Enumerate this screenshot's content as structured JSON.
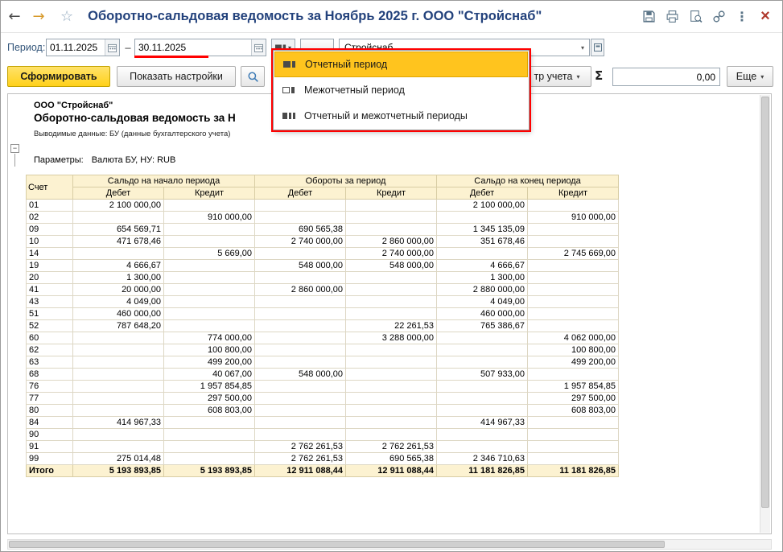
{
  "titlebar": {
    "title": "Оборотно-сальдовая ведомость за Ноябрь 2025 г. ООО \"Стройснаб\"",
    "back": "←",
    "forward": "→",
    "favorite_star": "☆",
    "menu_dots": "⋮",
    "close": "×"
  },
  "filters": {
    "period_label": "Период:",
    "date_from": "01.11.2025",
    "date_to": "30.11.2025",
    "range_dash": "–",
    "ellipsis_button": "...",
    "organization_value": "Стройснаб",
    "combo_arrow": "▾"
  },
  "period_menu": {
    "items": [
      {
        "label": "Отчетный период",
        "selected": true
      },
      {
        "label": "Межотчетный период",
        "selected": false
      },
      {
        "label": "Отчетный и межотчетный периоды",
        "selected": false
      }
    ]
  },
  "actions": {
    "generate": "Сформировать",
    "show_settings": "Показать настройки",
    "register_partial": "тр учета",
    "sigma": "Σ",
    "sum_value": "0,00",
    "more": "Еще",
    "dropdown_arrow": "▾"
  },
  "report": {
    "org_name": "ООО \"Стройснаб\"",
    "title_visible": "Оборотно-сальдовая ведомость за Н",
    "output_data": "Выводимые данные: БУ (данные бухгалтерского учета)",
    "params_label": "Параметры:",
    "params_value": "Валюта БУ, НУ: RUB",
    "collapse_marker": "−"
  },
  "table": {
    "account_header": "Счет",
    "groups": [
      "Сальдо на начало периода",
      "Обороты за период",
      "Сальдо на конец периода"
    ],
    "debit": "Дебет",
    "credit": "Кредит",
    "rows": [
      [
        "01",
        "2 100 000,00",
        "",
        "",
        "",
        "2 100 000,00",
        ""
      ],
      [
        "02",
        "",
        "910 000,00",
        "",
        "",
        "",
        "910 000,00"
      ],
      [
        "09",
        "654 569,71",
        "",
        "690 565,38",
        "",
        "1 345 135,09",
        ""
      ],
      [
        "10",
        "471 678,46",
        "",
        "2 740 000,00",
        "2 860 000,00",
        "351 678,46",
        ""
      ],
      [
        "14",
        "",
        "5 669,00",
        "",
        "2 740 000,00",
        "",
        "2 745 669,00"
      ],
      [
        "19",
        "4 666,67",
        "",
        "548 000,00",
        "548 000,00",
        "4 666,67",
        ""
      ],
      [
        "20",
        "1 300,00",
        "",
        "",
        "",
        "1 300,00",
        ""
      ],
      [
        "41",
        "20 000,00",
        "",
        "2 860 000,00",
        "",
        "2 880 000,00",
        ""
      ],
      [
        "43",
        "4 049,00",
        "",
        "",
        "",
        "4 049,00",
        ""
      ],
      [
        "51",
        "460 000,00",
        "",
        "",
        "",
        "460 000,00",
        ""
      ],
      [
        "52",
        "787 648,20",
        "",
        "",
        "22 261,53",
        "765 386,67",
        ""
      ],
      [
        "60",
        "",
        "774 000,00",
        "",
        "3 288 000,00",
        "",
        "4 062 000,00"
      ],
      [
        "62",
        "",
        "100 800,00",
        "",
        "",
        "",
        "100 800,00"
      ],
      [
        "63",
        "",
        "499 200,00",
        "",
        "",
        "",
        "499 200,00"
      ],
      [
        "68",
        "",
        "40 067,00",
        "548 000,00",
        "",
        "507 933,00",
        ""
      ],
      [
        "76",
        "",
        "1 957 854,85",
        "",
        "",
        "",
        "1 957 854,85"
      ],
      [
        "77",
        "",
        "297 500,00",
        "",
        "",
        "",
        "297 500,00"
      ],
      [
        "80",
        "",
        "608 803,00",
        "",
        "",
        "",
        "608 803,00"
      ],
      [
        "84",
        "414 967,33",
        "",
        "",
        "",
        "414 967,33",
        ""
      ],
      [
        "90",
        "",
        "",
        "",
        "",
        "",
        ""
      ],
      [
        "91",
        "",
        "",
        "2 762 261,53",
        "2 762 261,53",
        "",
        ""
      ],
      [
        "99",
        "275 014,48",
        "",
        "2 762 261,53",
        "690 565,38",
        "2 346 710,63",
        ""
      ]
    ],
    "total": [
      "Итого",
      "5 193 893,85",
      "5 193 893,85",
      "12 911 088,44",
      "12 911 088,44",
      "11 181 826,85",
      "11 181 826,85"
    ]
  },
  "colors": {
    "accent_yellow": "#ffd11a",
    "menu_highlight": "#ffc41e",
    "annotation_red": "#ff0000",
    "table_header_bg": "#fcf2d1",
    "title_blue": "#23427c"
  }
}
